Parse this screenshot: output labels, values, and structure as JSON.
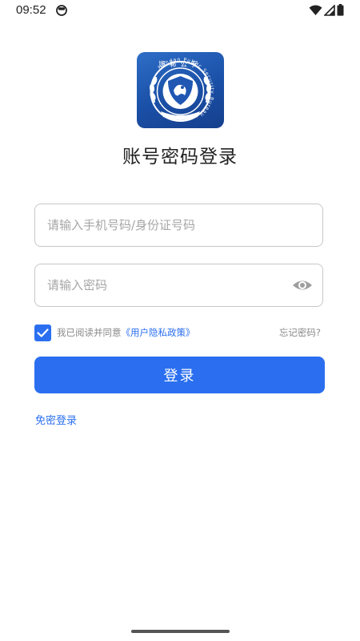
{
  "status_bar": {
    "time": "09:52",
    "icons": [
      "face-icon",
      "wifi-icon",
      "signal-icon",
      "battery-icon"
    ]
  },
  "logo": {
    "top_text": "邯郸公安",
    "ring_text": "Handan Public Security Bureau"
  },
  "page_title": "账号密码登录",
  "account_field": {
    "value": "",
    "placeholder": "请输入手机号码/身份证号码"
  },
  "password_field": {
    "value": "",
    "placeholder": "请输入密码",
    "icon": "eye-icon"
  },
  "agreement": {
    "checked": true,
    "text": "我已阅读并同意",
    "policy_link": "《用户隐私政策》"
  },
  "forgot_password": "忘记密码?",
  "login_button": "登录",
  "passwordless_login": "免密登录",
  "colors": {
    "accent": "#2b6ff0",
    "logo_blue": "#1a4fa6",
    "border": "#c7c7c7",
    "placeholder": "#a6a6a6"
  }
}
